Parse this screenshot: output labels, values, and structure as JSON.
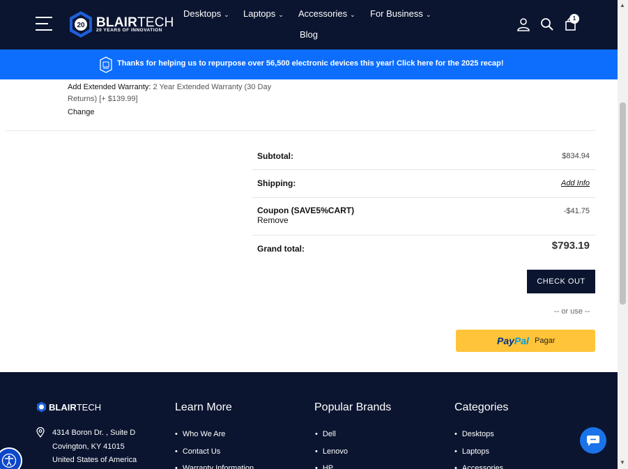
{
  "header": {
    "logo_name_bold": "BLAIR",
    "logo_name_light": "TECH",
    "logo_badge": "20",
    "logo_tagline": "20 YEARS OF INNOVATION",
    "nav": [
      {
        "label": "Desktops"
      },
      {
        "label": "Laptops"
      },
      {
        "label": "Accessories"
      },
      {
        "label": "For Business"
      },
      {
        "label": "Blog"
      }
    ],
    "cart_count": "1",
    "icons": [
      "menu-icon",
      "account-icon",
      "search-icon",
      "cart-icon"
    ]
  },
  "promo": {
    "text": "Thanks for helping us to repurpose over 56,500 electronic devices this year! Click here for the 2025 recap!"
  },
  "cart_item": {
    "warranty_label": "Add Extended Warranty:",
    "warranty_value": "2 Year Extended Warranty (30 Day Returns) [+ $139.99]",
    "change_label": "Change"
  },
  "totals": {
    "subtotal_label": "Subtotal:",
    "subtotal_value": "$834.94",
    "shipping_label": "Shipping:",
    "shipping_value": "Add Info",
    "coupon_label": "Coupon (SAVE5%CART)",
    "coupon_value": "-$41.75",
    "coupon_remove": "Remove",
    "grand_label": "Grand total:",
    "grand_value": "$793.19"
  },
  "checkout": {
    "button_label": "CHECK OUT",
    "or_use": "-- or use --",
    "paypal_pay": "Pay",
    "paypal_pal": "Pal",
    "paypal_pagar": "Pagar"
  },
  "footer": {
    "logo_bold": "BLAIR",
    "logo_light": "TECH",
    "address": [
      "4314 Boron Dr. , Suite D",
      "Covington, KY 41015",
      "United States of America"
    ],
    "learn_more_title": "Learn More",
    "learn_more": [
      "Who We Are",
      "Contact Us",
      "Warranty Information"
    ],
    "brands_title": "Popular Brands",
    "brands": [
      "Dell",
      "Lenovo",
      "HP"
    ],
    "categories_title": "Categories",
    "categories": [
      "Desktops",
      "Laptops",
      "Accessories"
    ]
  },
  "colors": {
    "navy": "#0b1530",
    "promo_blue": "#0d6efd",
    "paypal_yellow": "#ffc439",
    "chat_blue": "#1a73e8"
  }
}
